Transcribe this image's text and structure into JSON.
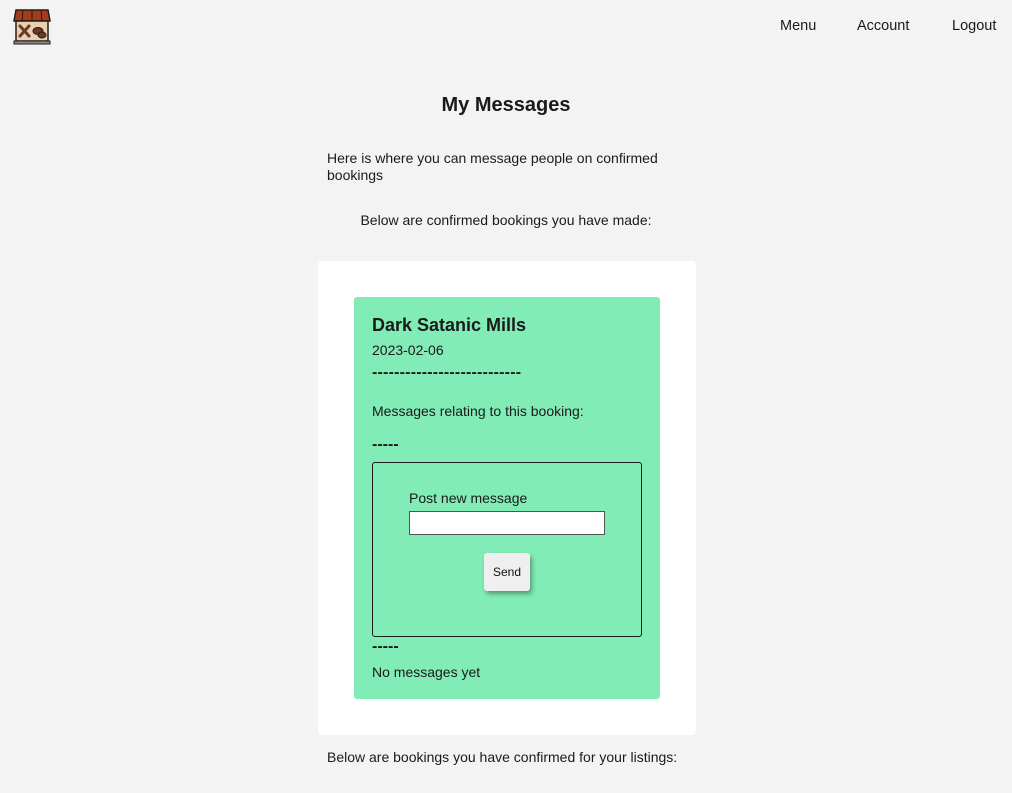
{
  "header": {
    "logo_icon": "shop-storefront-icon",
    "nav": {
      "menu": "Menu",
      "account": "Account",
      "logout": "Logout"
    }
  },
  "page": {
    "title": "My Messages",
    "intro": "Here is where you can message people on confirmed bookings",
    "made_heading": "Below are confirmed bookings you have made:",
    "listings_heading": "Below are bookings you have confirmed for your listings:"
  },
  "bookings_made": [
    {
      "title": "Dark Satanic Mills",
      "date": "2023-02-06",
      "divider_long": "---------------------------",
      "messages_label": "Messages relating to this booking:",
      "divider_short": "-----",
      "post_label": "Post new message",
      "post_value": "",
      "send_label": "Send",
      "no_messages": "No messages yet"
    }
  ],
  "colors": {
    "background": "#f3f3f3",
    "panel": "#ffffff",
    "card": "#82ecb6"
  }
}
